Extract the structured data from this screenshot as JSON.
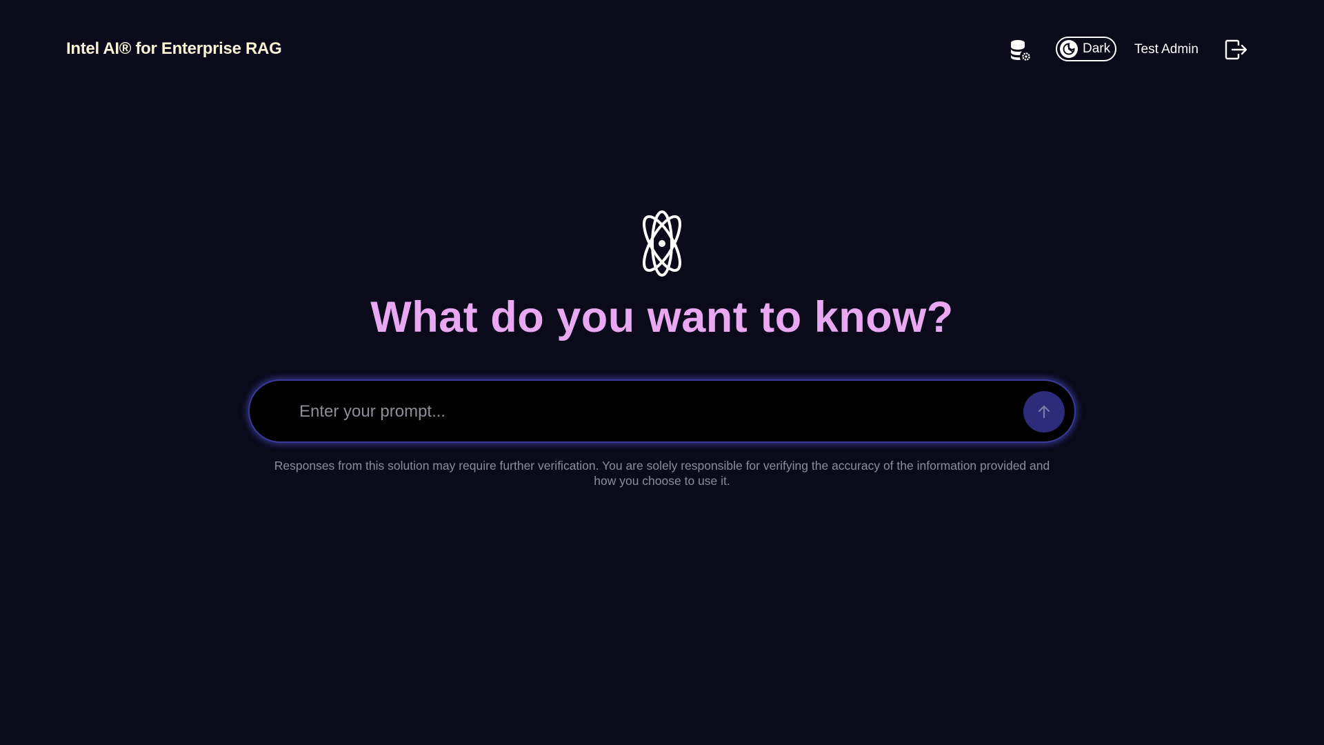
{
  "header": {
    "brand": "Intel AI® for Enterprise RAG",
    "db_settings_icon": "database-gear-icon",
    "theme_toggle": {
      "label": "Dark",
      "icon": "moon-icon",
      "state": "dark"
    },
    "user_name": "Test Admin",
    "logout_icon": "logout-icon"
  },
  "hero": {
    "icon": "atom-icon",
    "headline": "What do you want to know?"
  },
  "prompt": {
    "value": "",
    "placeholder": "Enter your prompt...",
    "send_icon": "arrow-up-icon"
  },
  "disclaimer": "Responses from this solution may require further verification. You are solely responsible for verifying the accuracy of the information provided and how you choose to use it.",
  "colors": {
    "background": "#0a0a1a",
    "brand_text": "#faf3d8",
    "headline": "#e9a8f2",
    "prompt_glow": "#5a5ae6",
    "send_button": "#2c2c7a",
    "disclaimer_text": "#8c8c9c"
  }
}
